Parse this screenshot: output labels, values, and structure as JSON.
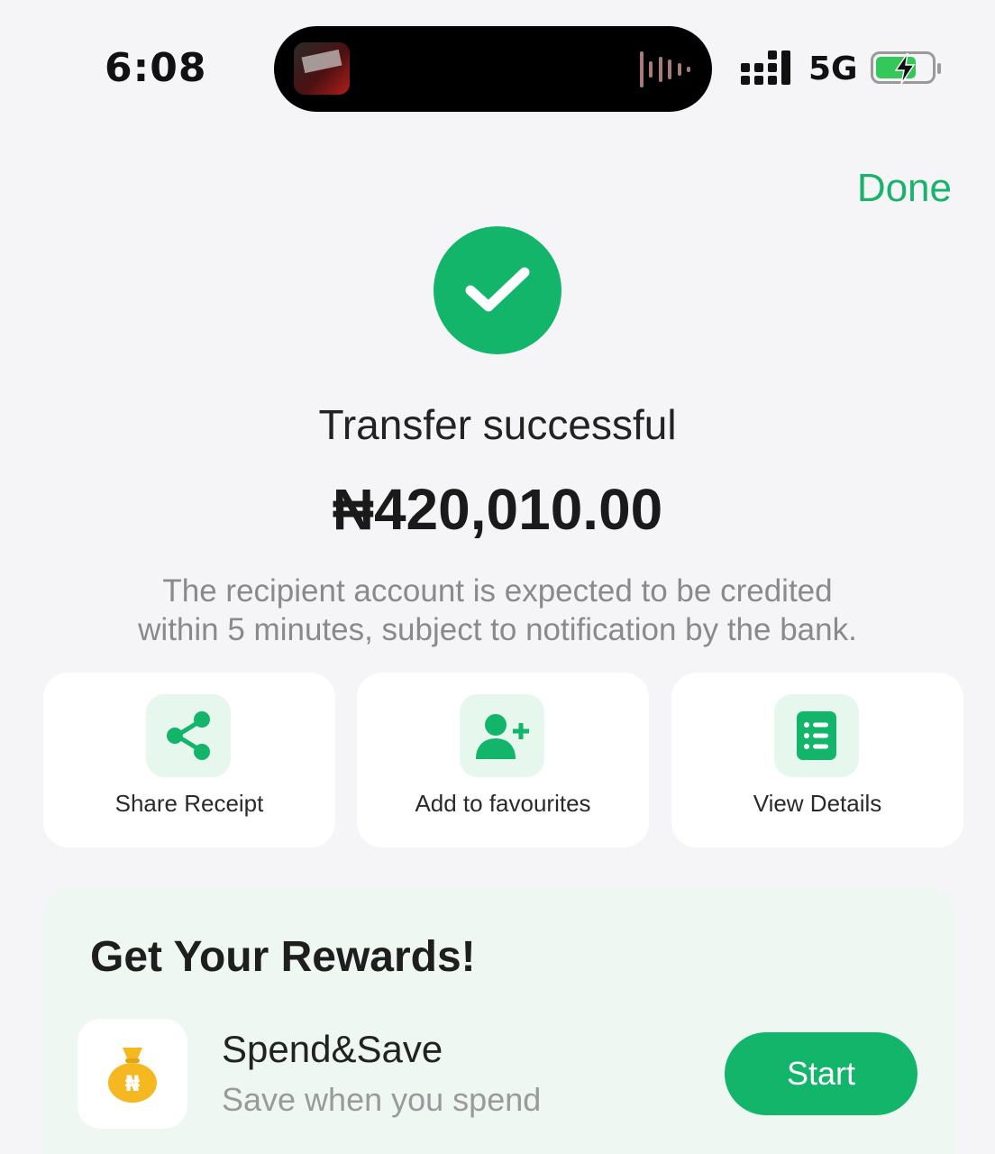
{
  "status_bar": {
    "time": "6:08",
    "network": "5G",
    "battery_level": 0.74,
    "charging": true
  },
  "header": {
    "done_label": "Done"
  },
  "result": {
    "title": "Transfer successful",
    "amount": "₦420,010.00",
    "note_line1": "The recipient account is expected to be credited",
    "note_line2": "within 5 minutes, subject to notification by the bank."
  },
  "actions": [
    {
      "label": "Share Receipt",
      "icon": "share-icon"
    },
    {
      "label": "Add to favourites",
      "icon": "add-user-icon"
    },
    {
      "label": "View Details",
      "icon": "details-list-icon"
    }
  ],
  "rewards": {
    "title": "Get Your Rewards!",
    "item": {
      "name": "Spend&Save",
      "description": "Save when you spend",
      "button": "Start",
      "icon": "money-bag-icon",
      "icon_symbol": "₦"
    }
  },
  "colors": {
    "accent": "#13b56b",
    "background": "#f5f5f8",
    "icon_tile": "#e6f7ee",
    "rewards_bg": "#eef7f2",
    "bag": "#f5b821"
  }
}
